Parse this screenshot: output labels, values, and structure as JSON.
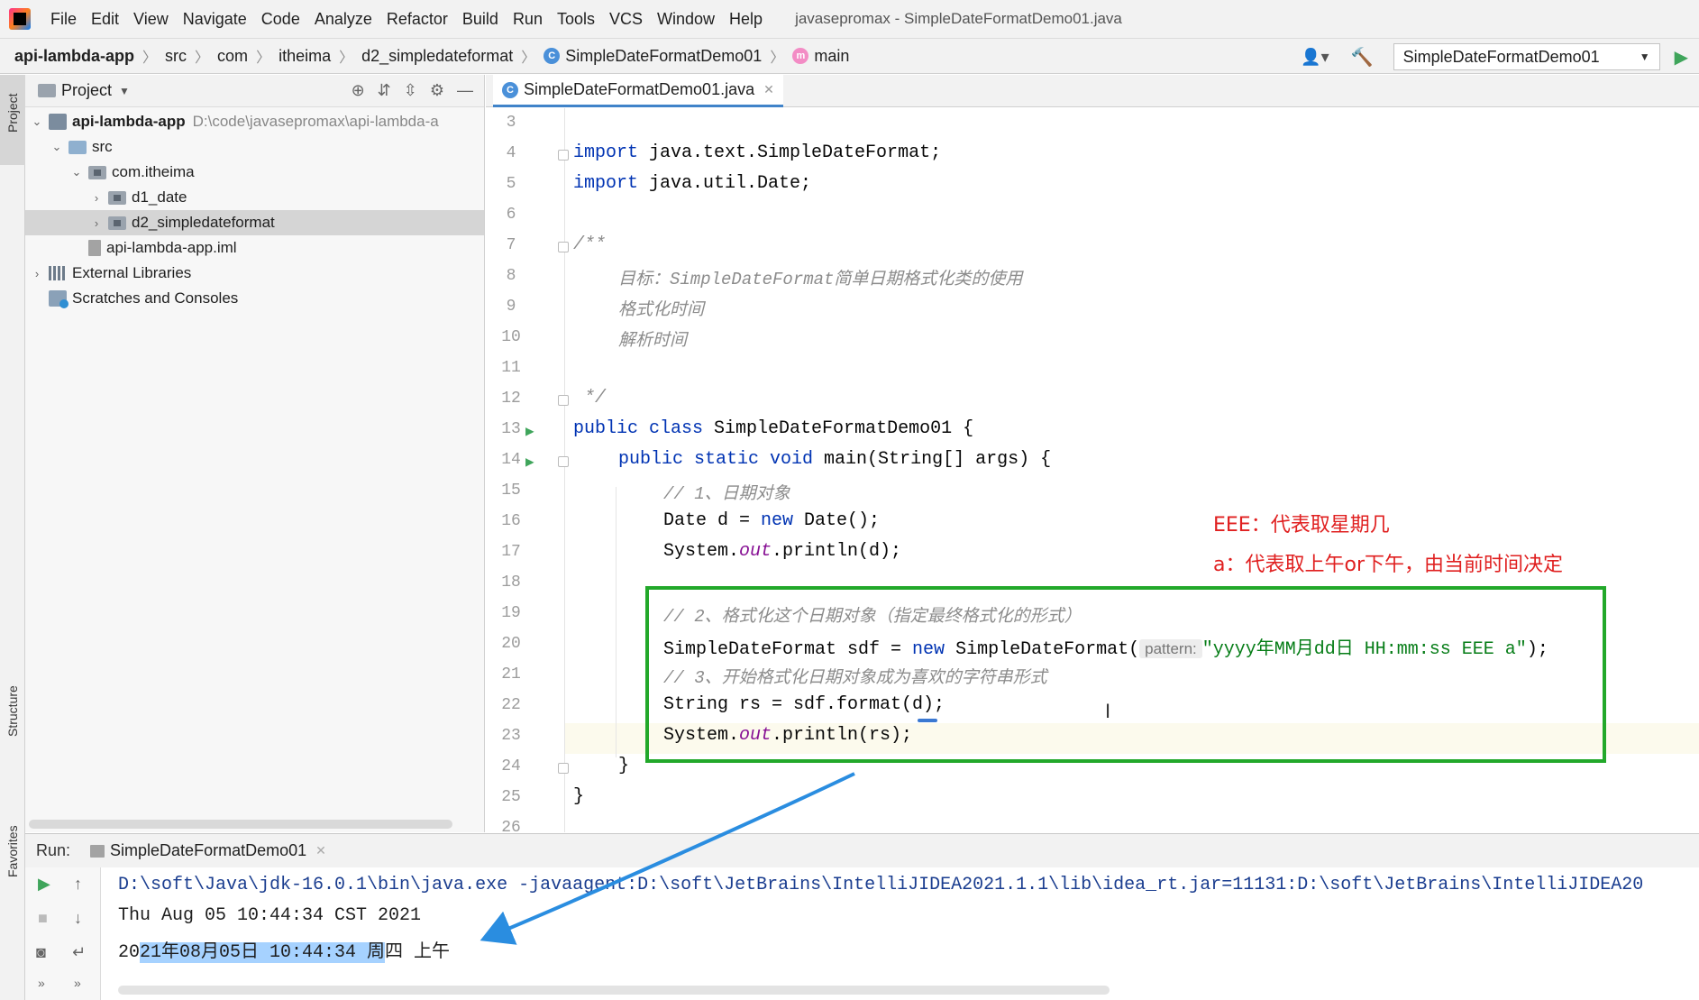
{
  "menubar": {
    "items": [
      "File",
      "Edit",
      "View",
      "Navigate",
      "Code",
      "Analyze",
      "Refactor",
      "Build",
      "Run",
      "Tools",
      "VCS",
      "Window",
      "Help"
    ],
    "window_title": "javasepromax - SimpleDateFormatDemo01.java"
  },
  "navbar": {
    "breadcrumbs": [
      "api-lambda-app",
      "src",
      "com",
      "itheima",
      "d2_simpledateformat",
      "SimpleDateFormatDemo01",
      "main"
    ],
    "run_config": "SimpleDateFormatDemo01"
  },
  "left_strip": {
    "project_label": "Project",
    "structure_label": "Structure",
    "favorites_label": "Favorites"
  },
  "project_panel": {
    "title": "Project",
    "tree": [
      {
        "label": "api-lambda-app",
        "path": "D:\\code\\javasepromax\\api-lambda-a"
      },
      {
        "label": "src"
      },
      {
        "label": "com.itheima"
      },
      {
        "label": "d1_date"
      },
      {
        "label": "d2_simpledateformat"
      },
      {
        "label": "api-lambda-app.iml"
      },
      {
        "label": "External Libraries"
      },
      {
        "label": "Scratches and Consoles"
      }
    ]
  },
  "editor": {
    "tab_label": "SimpleDateFormatDemo01.java",
    "line_numbers": [
      "3",
      "4",
      "5",
      "6",
      "7",
      "8",
      "9",
      "10",
      "11",
      "12",
      "13",
      "14",
      "15",
      "16",
      "17",
      "18",
      "19",
      "20",
      "21",
      "22",
      "23",
      "24",
      "25",
      "26"
    ],
    "code": {
      "l4_kw": "import",
      "l4_rest": " java.text.SimpleDateFormat;",
      "l5_kw": "import",
      "l5_rest": " java.util.Date;",
      "l7": "/**",
      "l8": "目标：SimpleDateFormat简单日期格式化类的使用",
      "l9": "格式化时间",
      "l10": "解析时间",
      "l12": " */",
      "l13_kw": "public class",
      "l13_rest": " SimpleDateFormatDemo01 {",
      "l14_kw": "public static void",
      "l14_rest": " main(String[] args) {",
      "l15": "// 1、日期对象",
      "l16_a": "Date d = ",
      "l16_kw": "new",
      "l16_b": " Date();",
      "l17_a": "System.",
      "l17_it": "out",
      "l17_b": ".println(d);",
      "l19": "// 2、格式化这个日期对象（指定最终格式化的形式）",
      "l20_a": "SimpleDateFormat sdf = ",
      "l20_kw": "new",
      "l20_b": " SimpleDateFormat(",
      "l20_hint": "pattern:",
      "l20_str": "\"yyyy年MM月dd日 HH:mm:ss EEE a\"",
      "l20_c": ");",
      "l21": "// 3、开始格式化日期对象成为喜欢的字符串形式",
      "l22": "String rs = sdf.format(d);",
      "l23_a": "System.",
      "l23_it": "out",
      "l23_b": ".println(rs);",
      "l24": "}",
      "l25": "}"
    },
    "annotations": {
      "note1": "EEE：代表取星期几",
      "note2": "a：代表取上午or下午，由当前时间决定"
    }
  },
  "run_panel": {
    "label": "Run:",
    "tab_label": "SimpleDateFormatDemo01",
    "console": {
      "line1": "D:\\soft\\Java\\jdk-16.0.1\\bin\\java.exe -javaagent:D:\\soft\\JetBrains\\IntelliJIDEA2021.1.1\\lib\\idea_rt.jar=11131:D:\\soft\\JetBrains\\IntelliJIDEA20",
      "line2": "Thu Aug 05 10:44:34 CST 2021",
      "line3_pre": "20",
      "line3_sel": "21年08月05日 10:44:34 周",
      "line3_post": "四 上午"
    }
  },
  "colors": {
    "highlight_box": "#22a82a",
    "annotation_text": "#e02020",
    "arrow": "#2a8de0"
  }
}
